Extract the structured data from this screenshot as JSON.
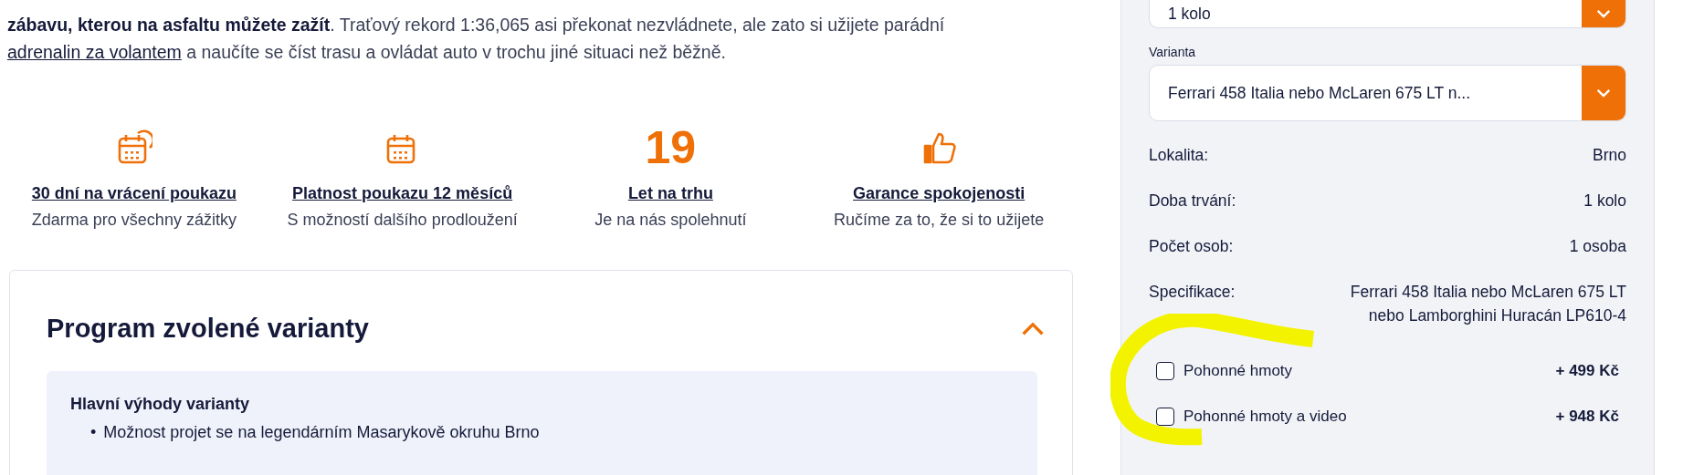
{
  "intro": {
    "text": "**zábavu, kterou na asfaltu můžete zažít**. Traťový rekord 1:36,065 asi překonat nezvládnete, ale zato si užijete parádní ",
    "link": "adrenalin za volantem",
    "after": " a naučíte se číst trasu a ovládat auto v trochu jiné situaci než běžně."
  },
  "features": [
    {
      "kind": "calendar-return",
      "title": "30 dní na vrácení poukazu",
      "subtitle": "Zdarma pro všechny zážitky"
    },
    {
      "kind": "calendar",
      "title": "Platnost poukazu 12 měsíců",
      "subtitle": "S možností dalšího prodloužení"
    },
    {
      "kind": "number",
      "number": "19",
      "title": "Let na trhu",
      "subtitle": "Je na nás spolehnutí"
    },
    {
      "kind": "thumb",
      "title": "Garance spokojenosti",
      "subtitle": "Ručíme za to, že si to užijete"
    }
  ],
  "program": {
    "title": "Program zvolené varianty",
    "expanded": true,
    "subtitle": "Hlavní výhody varianty",
    "marker": "•",
    "bullets": [
      "Možnost projet se na legendárním Masarykově okruhu Brno"
    ]
  },
  "sidebar": {
    "selects": [
      {
        "value": "1 kolo"
      },
      {
        "label": "Varianta",
        "value": "Ferrari 458 Italia nebo McLaren 675 LT n..."
      }
    ],
    "details": [
      {
        "label": "Lokalita:",
        "value": "Brno"
      },
      {
        "label": "Doba trvání:",
        "value": "1 kolo"
      },
      {
        "label": "Počet osob:",
        "value": "1 osoba"
      },
      {
        "label": "Specifikace:",
        "value": "Ferrari 458 Italia nebo McLaren 675 LT nebo Lamborghini Huracán LP610-4"
      }
    ],
    "extras": [
      {
        "label": "Pohonné hmoty",
        "price": "+ 499 Kč",
        "checked": false
      },
      {
        "label": "Pohonné hmoty a video",
        "price": "+ 948 Kč",
        "checked": false
      }
    ]
  }
}
